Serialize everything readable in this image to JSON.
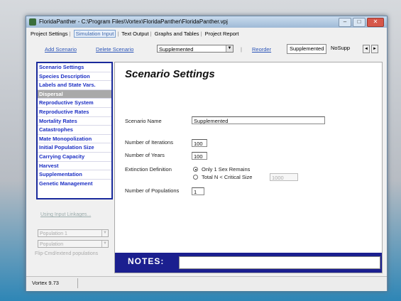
{
  "window": {
    "title": "FloridaPanther - C:\\Program Files\\Vortex\\FloridaPanther\\FloridaPanther.vpj",
    "min": "–",
    "max": "□",
    "close": "✕"
  },
  "menu_tabs": [
    "Project Settings",
    "Simulation Input",
    "Text Output",
    "Graphs and Tables",
    "Project Report"
  ],
  "toolbar": {
    "add_scenario": "Add Scenario",
    "delete_scenario": "Delete Scenario",
    "scenario_select": "Supplemented",
    "pipe": "|",
    "reorder": "Reorder",
    "scenario_tabs": [
      "Supplemented",
      "NoSupp"
    ],
    "scroll_left": "◄",
    "scroll_right": "►"
  },
  "sidebar": {
    "items": [
      "Scenario Settings",
      "Species Description",
      "Labels and State Vars.",
      "Dispersal",
      "Reproductive System",
      "Reproductive Rates",
      "Mortality Rates",
      "Catastrophes",
      "Mate Monopolization",
      "Initial Population Size",
      "Carrying Capacity",
      "Harvest",
      "Supplementation",
      "Genetic Management"
    ],
    "active_index": 3,
    "disabled_link": "Using Input Linkages...",
    "disabled_combo_1": "Population 1",
    "disabled_combo_2": "Population",
    "disabled_note": "Flip-Cmd/extend populations"
  },
  "content": {
    "heading": "Scenario Settings",
    "scenario_name_label": "Scenario Name",
    "scenario_name_value": "Supplemented",
    "iterations_label": "Number of Iterations",
    "iterations_value": "100",
    "years_label": "Number of Years",
    "years_value": "100",
    "extinction_label": "Extinction Definition",
    "option_1": "Only 1 Sex Remains",
    "option_2": "Total N < Critical Size",
    "critical_size_value": "1000",
    "populations_label": "Number of Populations",
    "populations_value": "1"
  },
  "notes": {
    "label": "NOTES:"
  },
  "statusbar": {
    "version": "Vortex 9.73"
  },
  "colors": {
    "nav_border": "#1a2a9c",
    "nav_text": "#1c2fc4",
    "notes_bg": "#1b1f8f",
    "link": "#2c55b8"
  }
}
